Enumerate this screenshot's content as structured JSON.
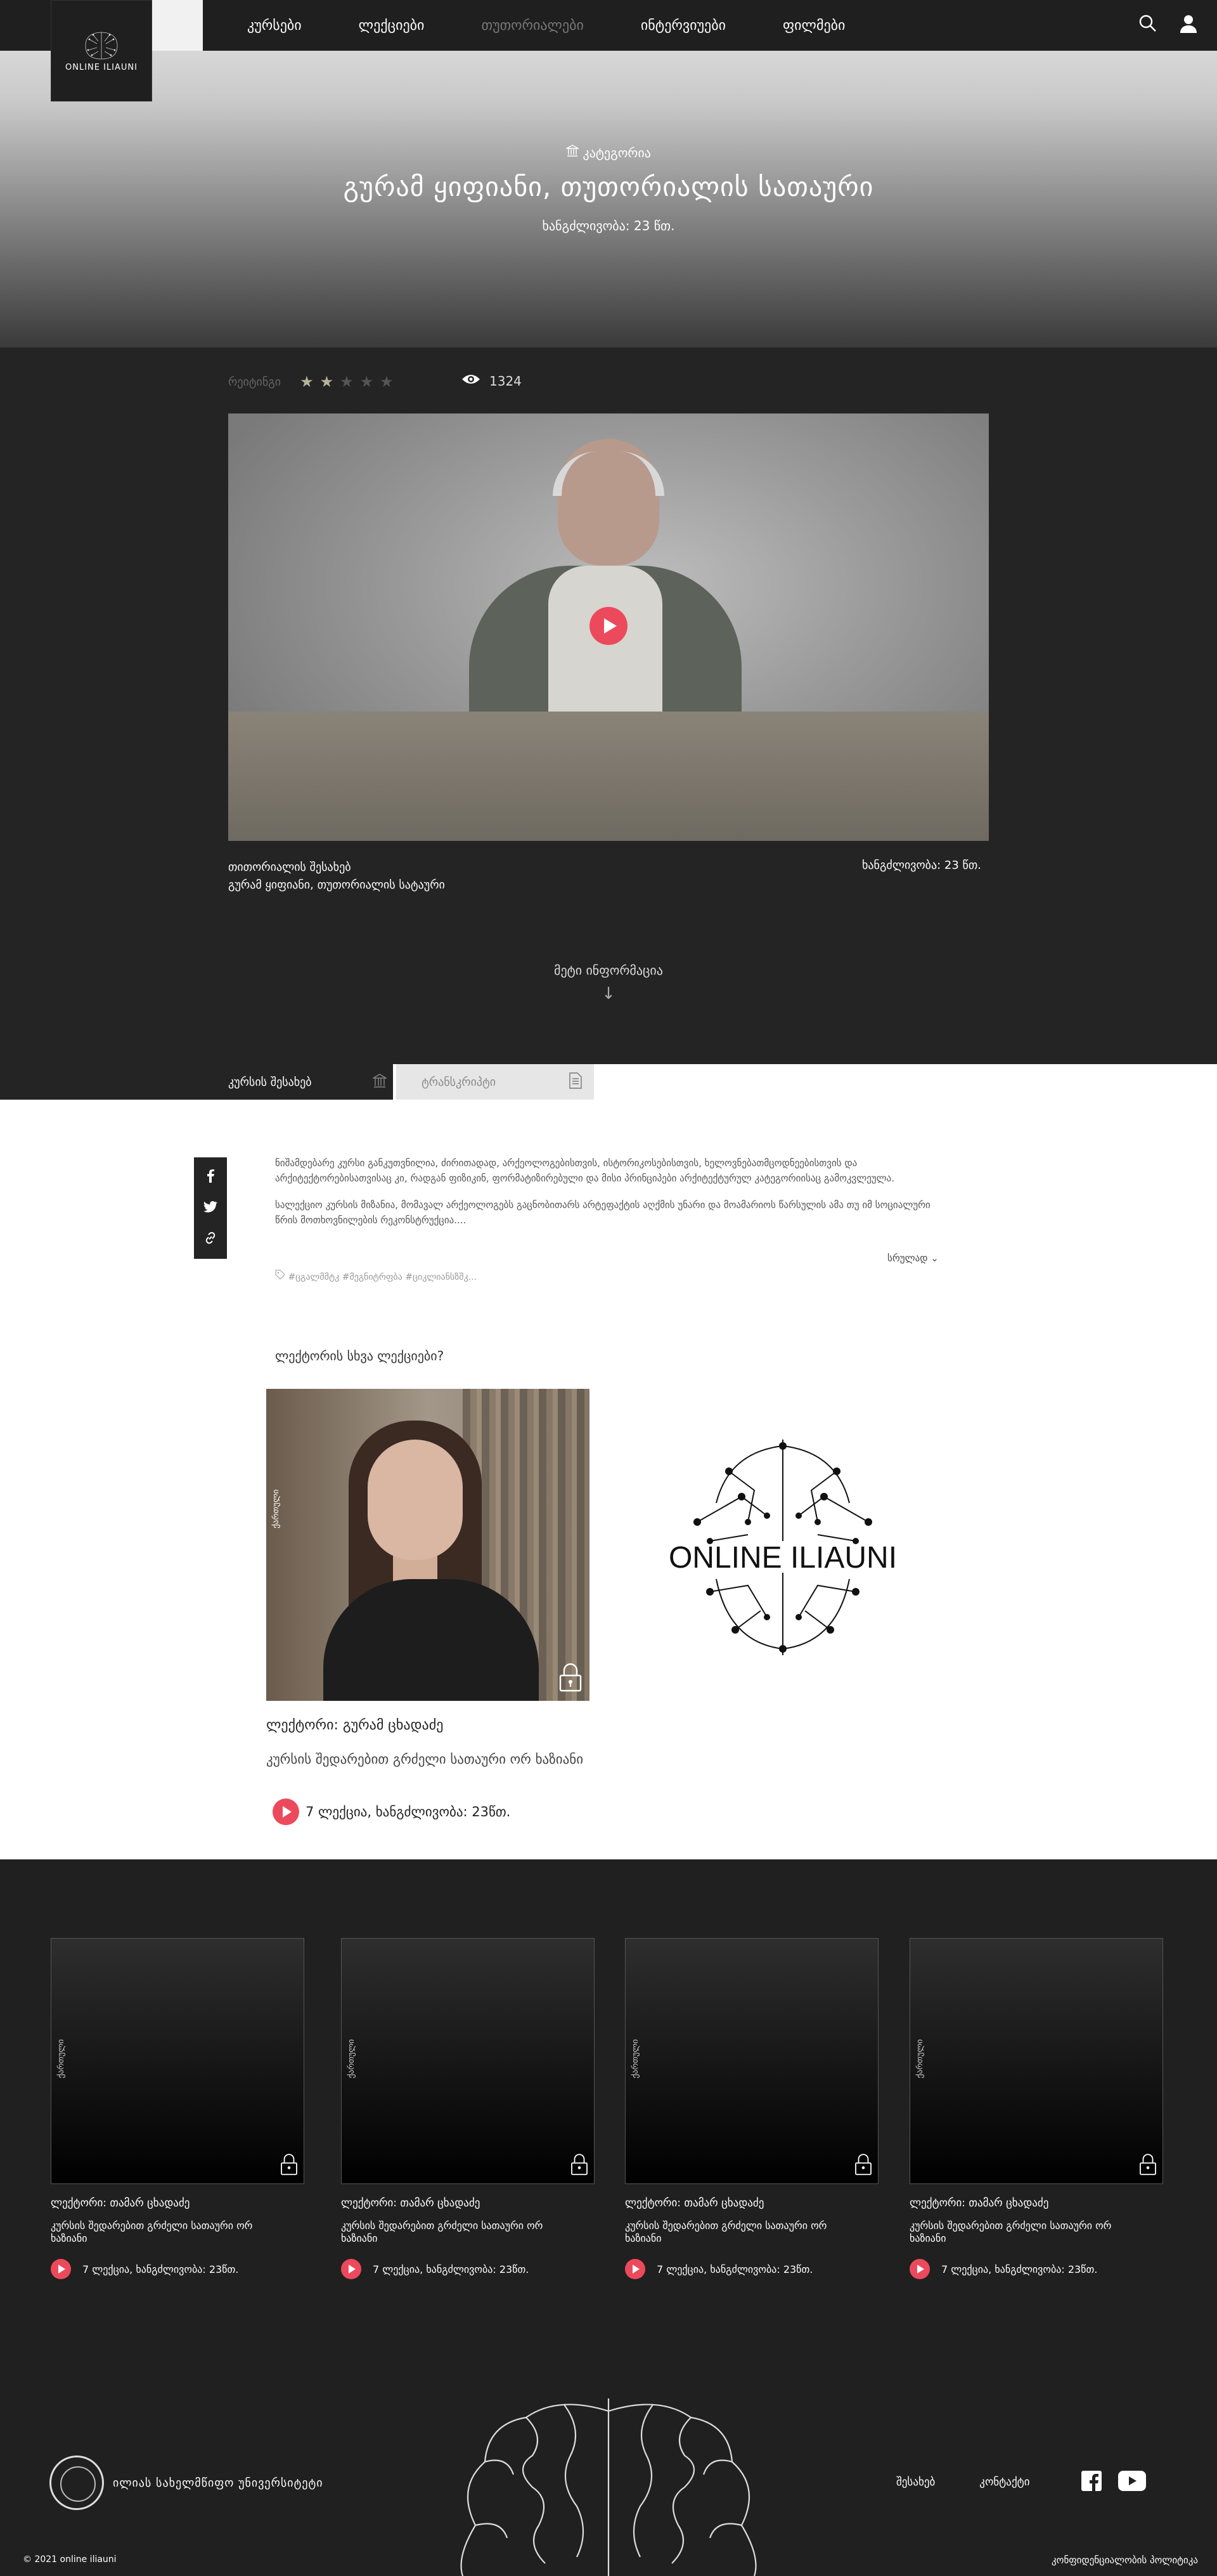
{
  "brand": {
    "logo_text": "ONLINE ILIAUNI"
  },
  "nav": {
    "items": [
      {
        "label": "კურსები"
      },
      {
        "label": "ლექციები"
      },
      {
        "label": "თუთორიალები"
      },
      {
        "label": "ინტერვიუები"
      },
      {
        "label": "ფილმები"
      }
    ]
  },
  "hero": {
    "category": "კატეგორია",
    "title": "გურამ ყიფიანი, თუთორიალის სათაური",
    "duration": "ხანგძლივობა: 23 წთ."
  },
  "video": {
    "rating_label": "რეიტინგი",
    "rating_value": 2,
    "rating_max": 5,
    "views": "1324",
    "info_title": "თითორიალის შესახებ",
    "info_subtitle": "გურამ ყიფიანი, თუთორიალის სატაური",
    "duration": "ხანგძლივობა: 23 წთ.",
    "more_label": "მეტი ინფორმაცია"
  },
  "tabs": {
    "about": "კურსის შესახებ",
    "transcript": "ტრანსკრიპტი"
  },
  "description": {
    "paragraph1": "ნიშამდებარე კურსი განკუთვნილია, ძირითადად, არქეოლოგებისთვის, ისტორიკოსებისთვის, ხელოვნებათმცოდნეებისთვის და არქიტექტორებისათვისაც კი, რადგან ფიზიკინ, ფორმატიზირებული და მისი პრინციპები არქიტექტურულ კატეგორიისაც გამოკვლეულა.",
    "paragraph2": "სალექციო კურსის მიზანია, მომავალ არქეოლოგებს გაცნობითარს არტეფაქტის აღქმის უნარი და მოამარიოს წარსულის ამა თუ იმ სოციალური წრის მოთხოვნილების რეკონსტრუქცია....",
    "see_more": "სრულად",
    "tags": "#ცგალმმტკ #მეგნიტრფბა #ციკლიანსზშკ..."
  },
  "other": {
    "heading": "ლექტორის სხვა ლექციები?",
    "card": {
      "vertical_label": "ქართული",
      "lecturer": "ლექტორი: გურამ ცხადაძე",
      "title": "კურსის შედარებით გრძელი სათაური ორ ხაზიანი",
      "meta": "7 ლექცია, ხანგძლივობა: 23წთ."
    },
    "logo_text": "ONLINE ILIAUNI"
  },
  "more_cards": [
    {
      "vertical_label": "ქართული",
      "lecturer": "ლექტორი: თამარ ცხადაძე",
      "title": "კურსის შედარებით გრძელი სათაური ორ ხაზიანი",
      "meta": "7 ლექცია, ხანგძლივობა: 23წთ."
    },
    {
      "vertical_label": "ქართული",
      "lecturer": "ლექტორი: თამარ ცხადაძე",
      "title": "კურსის შედარებით გრძელი სათაური ორ ხაზიანი",
      "meta": "7 ლექცია, ხანგძლივობა: 23წთ."
    },
    {
      "vertical_label": "ქართული",
      "lecturer": "ლექტორი: თამარ ცხადაძე",
      "title": "კურსის შედარებით გრძელი სათაური ორ ხაზიანი",
      "meta": "7 ლექცია, ხანგძლივობა: 23წთ."
    },
    {
      "vertical_label": "ქართული",
      "lecturer": "ლექტორი: თამარ ცხადაძე",
      "title": "კურსის შედარებით გრძელი სათაური ორ ხაზიანი",
      "meta": "7 ლექცია, ხანგძლივობა: 23წთ."
    }
  ],
  "footer": {
    "university": "ილიას სახელმწიფო უნივერსიტეტი",
    "about": "შესახებ",
    "contact": "კონტაქტი",
    "copyright": "© 2021 online iliauni",
    "privacy": "კონფიდენციალობის პოლიტიკა"
  },
  "colors": {
    "accent": "#ec4a5c",
    "dark": "#242424",
    "star_on": "#b8b49a"
  },
  "icons": [
    "search-icon",
    "user-icon",
    "eye-icon",
    "play-icon",
    "facebook-icon",
    "twitter-icon",
    "link-icon",
    "tag-icon",
    "lock-icon",
    "column-icon",
    "document-icon",
    "youtube-icon",
    "arrow-down-icon",
    "chevron-down-icon"
  ]
}
